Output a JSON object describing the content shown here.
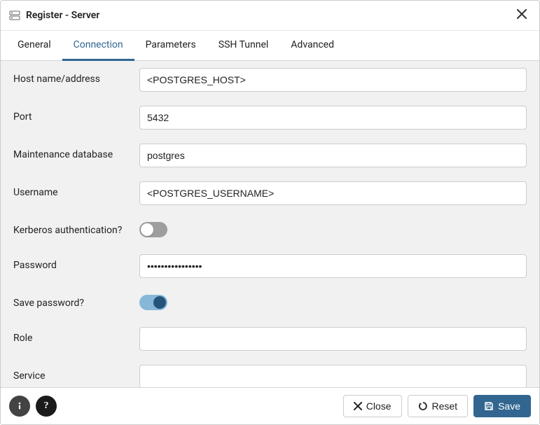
{
  "window": {
    "title": "Register - Server"
  },
  "tabs": [
    {
      "label": "General"
    },
    {
      "label": "Connection"
    },
    {
      "label": "Parameters"
    },
    {
      "label": "SSH Tunnel"
    },
    {
      "label": "Advanced"
    }
  ],
  "form": {
    "host": {
      "label": "Host name/address",
      "value": "<POSTGRES_HOST>"
    },
    "port": {
      "label": "Port",
      "value": "5432"
    },
    "maintenance_db": {
      "label": "Maintenance database",
      "value": "postgres"
    },
    "username": {
      "label": "Username",
      "value": "<POSTGRES_USERNAME>"
    },
    "kerberos": {
      "label": "Kerberos authentication?"
    },
    "password": {
      "label": "Password",
      "value": "••••••••••••••••"
    },
    "save_password": {
      "label": "Save password?"
    },
    "role": {
      "label": "Role",
      "value": ""
    },
    "service": {
      "label": "Service",
      "value": ""
    }
  },
  "footer": {
    "close_label": "Close",
    "reset_label": "Reset",
    "save_label": "Save"
  }
}
